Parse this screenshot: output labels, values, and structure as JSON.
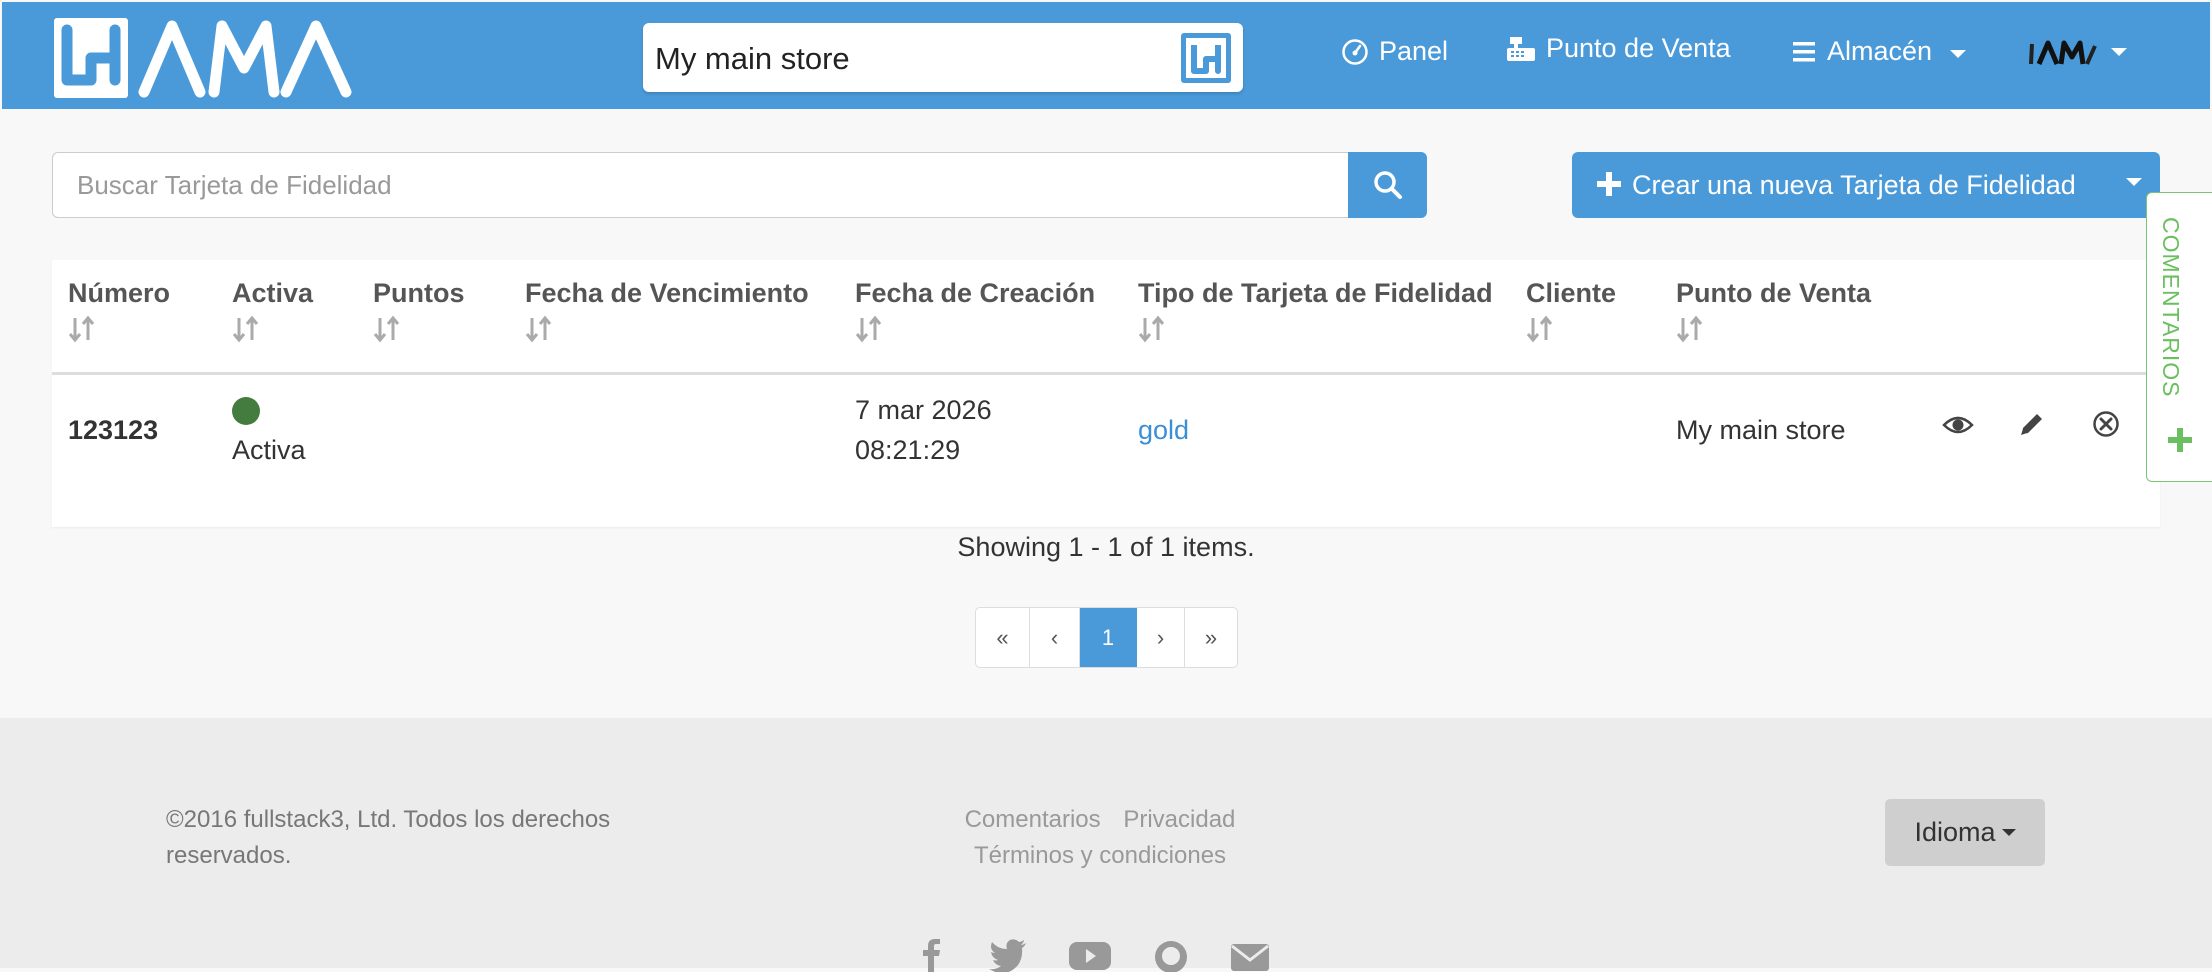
{
  "navbar": {
    "store_name": "My main store",
    "panel_label": "Panel",
    "pos_label": "Punto de Venta",
    "warehouse_label": "Almacén",
    "brand_color": "#4a9ad9"
  },
  "search": {
    "placeholder": "Buscar Tarjeta de Fidelidad"
  },
  "create_button": {
    "label": "Crear una nueva Tarjeta de Fidelidad"
  },
  "table": {
    "columns": [
      "Número",
      "Activa",
      "Puntos",
      "Fecha de Vencimiento",
      "Fecha de Creación",
      "Tipo de Tarjeta de Fidelidad",
      "Cliente",
      "Punto de Venta"
    ],
    "rows": [
      {
        "number": "123123",
        "active_label": "Activa",
        "active_color": "#447c3f",
        "points": "",
        "expiry": "",
        "created_date": "7 mar 2026",
        "created_time": "08:21:29",
        "card_type": "gold",
        "customer": "",
        "point_of_sale": "My main store"
      }
    ]
  },
  "pagination": {
    "summary": "Showing 1 - 1 of 1 items.",
    "first": "«",
    "prev": "‹",
    "current": "1",
    "next": "›",
    "last": "»"
  },
  "footer": {
    "copyright": "©2016 fullstack3, Ltd. Todos los derechos reservados.",
    "link_feedback": "Comentarios",
    "link_privacy": "Privacidad",
    "link_terms": "Términos y condiciones",
    "language_button": "Idioma",
    "social_icons": [
      "facebook-icon",
      "twitter-icon",
      "youtube-icon",
      "github-icon",
      "envelope-icon"
    ]
  },
  "feedback_tab": {
    "label": "COMENTARIOS",
    "accent": "#6cbf60"
  }
}
